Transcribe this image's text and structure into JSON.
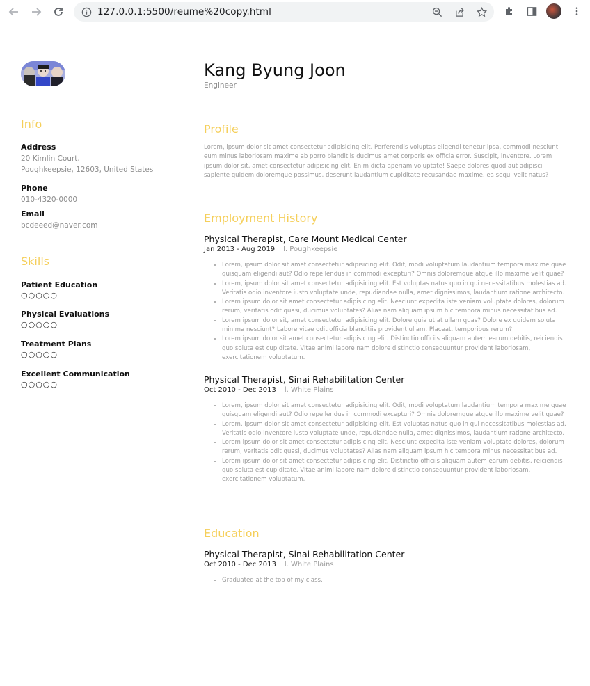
{
  "browser": {
    "url": "127.0.0.1:5500/reume%20copy.html"
  },
  "sidebar": {
    "info_title": "Info",
    "address_label": "Address",
    "address_line1": "20 Kimlin Court,",
    "address_line2": "Poughkeepsie, 12603, United States",
    "phone_label": "Phone",
    "phone_value": "010-4320-0000",
    "email_label": "Email",
    "email_value": "bcdeeed@naver.com",
    "skills_title": "Skills",
    "skills": [
      {
        "name": "Patient Education",
        "rating": "○○○○○"
      },
      {
        "name": "Physical Evaluations",
        "rating": "○○○○○"
      },
      {
        "name": "Treatment Plans",
        "rating": "○○○○○"
      },
      {
        "name": "Excellent Communication",
        "rating": "○○○○○"
      }
    ]
  },
  "header": {
    "name": "Kang Byung Joon",
    "role": "Engineer"
  },
  "profile": {
    "title": "Profile",
    "text": "Lorem, ipsum dolor sit amet consectetur adipisicing elit. Perferendis voluptas eligendi tenetur ipsa, commodi nesciunt eum minus laboriosam maxime ab porro blanditiis ducimus amet corporis ex officia error. Suscipit, inventore. Lorem ipsum dolor sit, amet consectetur adipisicing elit. Enim dicta aperiam voluptate! Saepe dolores quod aut adipisci sapiente quidem doloremque possimus, deserunt laudantium cupiditate recusandae maxime, ea sequi velit natus?"
  },
  "employment": {
    "title": "Employment History",
    "jobs": [
      {
        "title": "Physical Therapist, Care Mount Medical Center",
        "dates": "Jan 2013 - Aug 2019",
        "location": "l. Poughkeepsie",
        "bullets": [
          "Lorem, ipsum dolor sit amet consectetur adipisicing elit. Odit, modi voluptatum laudantium tempora maxime quae quisquam eligendi aut? Odio repellendus in commodi excepturi? Omnis doloremque atque illo maxime velit quae?",
          "Lorem, ipsum dolor sit amet consectetur adipisicing elit. Est voluptas natus quo in qui necessitatibus molestias ad. Veritatis odio inventore iusto voluptate unde, repudiandae nulla, amet dignissimos, laudantium ratione architecto.",
          "Lorem ipsum dolor sit amet consectetur adipisicing elit. Nesciunt expedita iste veniam voluptate dolores, dolorum rerum, veritatis odit quasi, ducimus voluptates? Alias nam aliquam ipsum hic tempora minus necessitatibus ad.",
          "Lorem ipsum dolor sit, amet consectetur adipisicing elit. Dolore quia ut at ullam quas? Dolore ex quidem soluta minima nesciunt? Labore vitae odit officia blanditiis provident ullam. Placeat, temporibus rerum?",
          "Lorem ipsum dolor sit amet consectetur adipisicing elit. Distinctio officiis aliquam autem earum debitis, reiciendis quo soluta est cupiditate. Vitae animi labore nam dolore distinctio consequuntur provident laboriosam, exercitationem voluptatum."
        ]
      },
      {
        "title": "Physical Therapist, Sinai Rehabilitation Center",
        "dates": "Oct 2010 - Dec 2013",
        "location": "l. White Plains",
        "bullets": [
          "Lorem, ipsum dolor sit amet consectetur adipisicing elit. Odit, modi voluptatum laudantium tempora maxime quae quisquam eligendi aut? Odio repellendus in commodi excepturi? Omnis doloremque atque illo maxime velit quae?",
          "Lorem, ipsum dolor sit amet consectetur adipisicing elit. Est voluptas natus quo in qui necessitatibus molestias ad. Veritatis odio inventore iusto voluptate unde, repudiandae nulla, amet dignissimos, laudantium ratione architecto.",
          "Lorem ipsum dolor sit amet consectetur adipisicing elit. Nesciunt expedita iste veniam voluptate dolores, dolorum rerum, veritatis odit quasi, ducimus voluptates? Alias nam aliquam ipsum hic tempora minus necessitatibus ad.",
          "Lorem ipsum dolor sit amet consectetur adipisicing elit. Distinctio officiis aliquam autem earum debitis, reiciendis quo soluta est cupiditate. Vitae animi labore nam dolore distinctio consequuntur provident laboriosam, exercitationem voluptatum."
        ]
      }
    ]
  },
  "education": {
    "title": "Education",
    "entry_title": "Physical Therapist, Sinai Rehabilitation Center",
    "dates": "Oct 2010 - Dec 2013",
    "location": "l. White Plains",
    "bullets": [
      "Graduated at the top of my class."
    ]
  }
}
